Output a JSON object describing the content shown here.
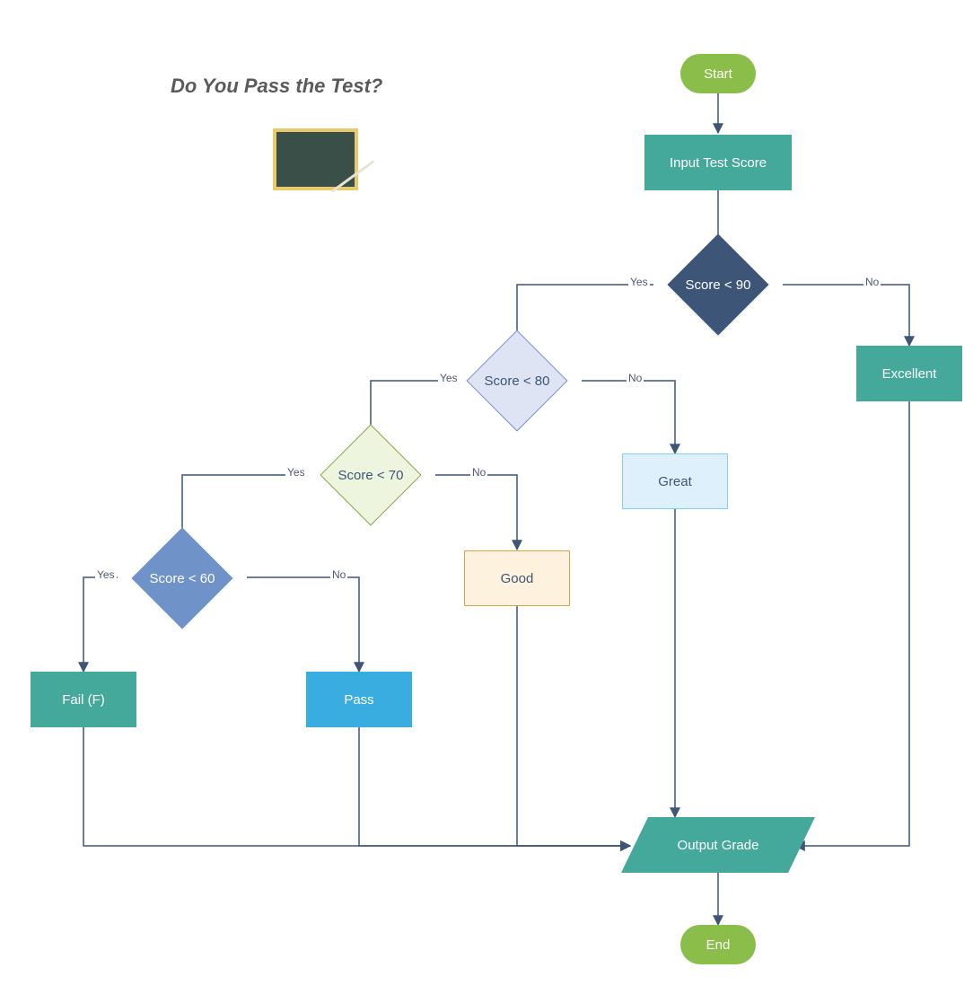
{
  "title": "Do You Pass the Test?",
  "terminator": {
    "start": "Start",
    "end": "End"
  },
  "process": {
    "input": "Input Test Score",
    "excellent": "Excellent",
    "great": "Great",
    "good": "Good",
    "pass": "Pass",
    "fail": "Fail (F)",
    "output": "Output Grade"
  },
  "decision": {
    "lt90": "Score < 90",
    "lt80": "Score < 80",
    "lt70": "Score < 70",
    "lt60": "Score < 60"
  },
  "labels": {
    "yes": "Yes",
    "no": "No"
  },
  "colors": {
    "green": "#8bbd4a",
    "teal": "#44a99a",
    "navy": "#3d5576",
    "lavender": "#dfe4f4",
    "lavenderBorder": "#8191c2",
    "lightgreen": "#eef5df",
    "lightgreenBorder": "#8aa84e",
    "blue": "#6f93c9",
    "lightblue": "#def0fb",
    "lightblueBorder": "#86d0ef",
    "cream": "#fdf2dd",
    "creamBorder": "#d9a542",
    "skyblue": "#3aade0",
    "textDark": "#3d5576"
  },
  "flow": {
    "decisions": [
      {
        "id": "lt90",
        "yes_to": "lt80",
        "no_to": "excellent"
      },
      {
        "id": "lt80",
        "yes_to": "lt70",
        "no_to": "great"
      },
      {
        "id": "lt70",
        "yes_to": "lt60",
        "no_to": "good"
      },
      {
        "id": "lt60",
        "yes_to": "fail",
        "no_to": "pass"
      }
    ],
    "results_go_to": "output",
    "output_goes_to": "end"
  }
}
